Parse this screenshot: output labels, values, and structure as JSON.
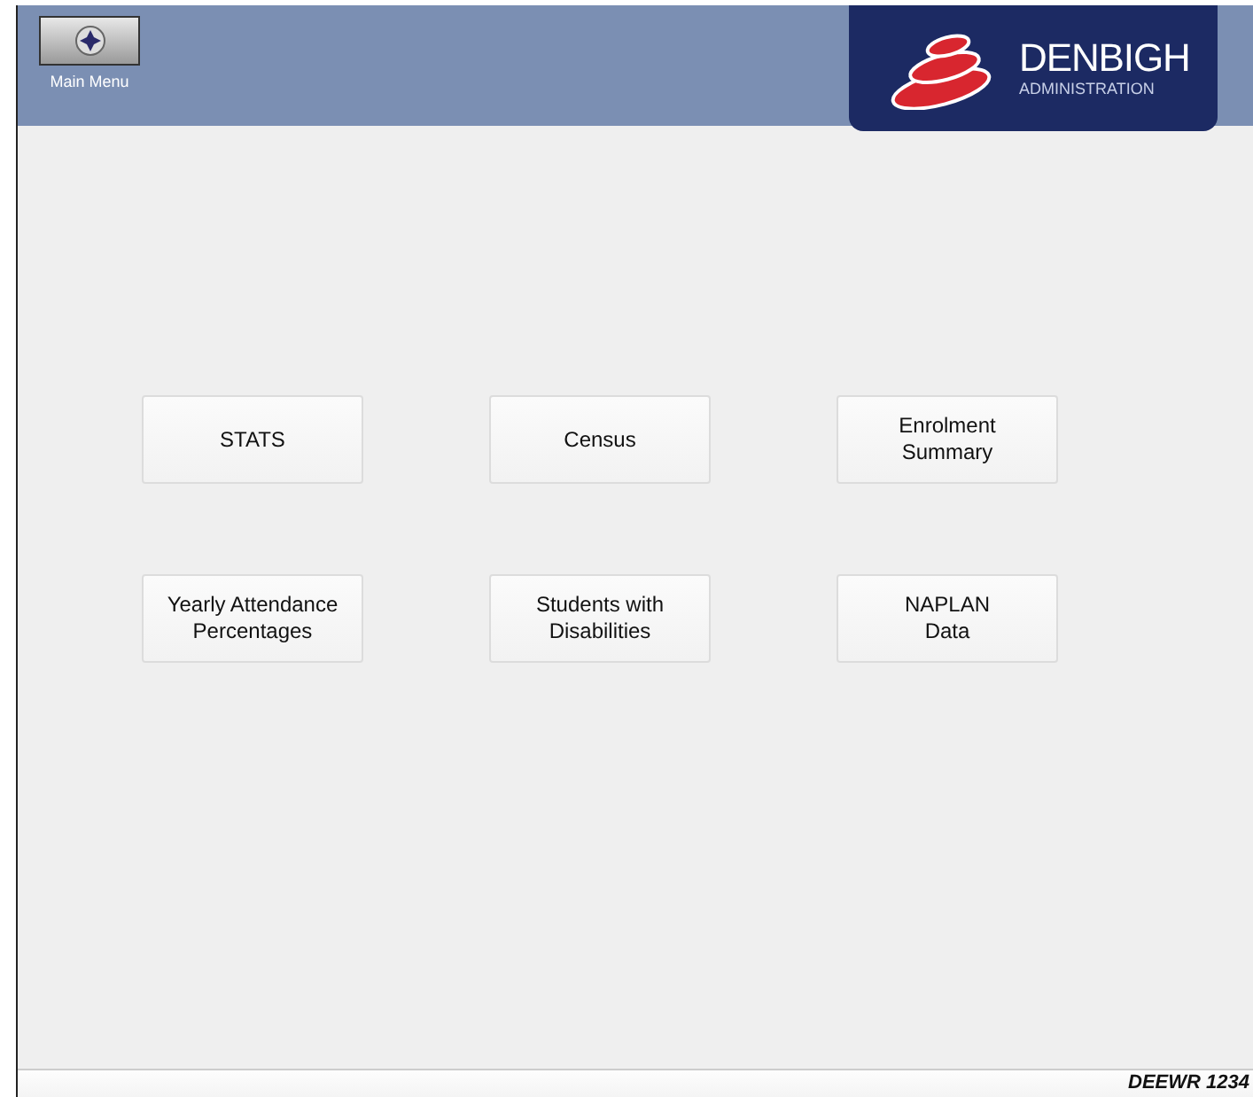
{
  "header": {
    "main_menu_label": "Main Menu",
    "brand": {
      "name": "DENBIGH",
      "tagline": "ADMINISTRATION"
    }
  },
  "buttons": [
    {
      "lines": [
        "STATS"
      ]
    },
    {
      "lines": [
        "Census"
      ]
    },
    {
      "lines": [
        "Enrolment",
        "Summary"
      ]
    },
    {
      "lines": [
        "Yearly Attendance",
        "Percentages"
      ]
    },
    {
      "lines": [
        "Students with",
        "Disabilities"
      ]
    },
    {
      "lines": [
        "NAPLAN",
        "Data"
      ]
    }
  ],
  "footer": {
    "text": "DEEWR 1234"
  }
}
